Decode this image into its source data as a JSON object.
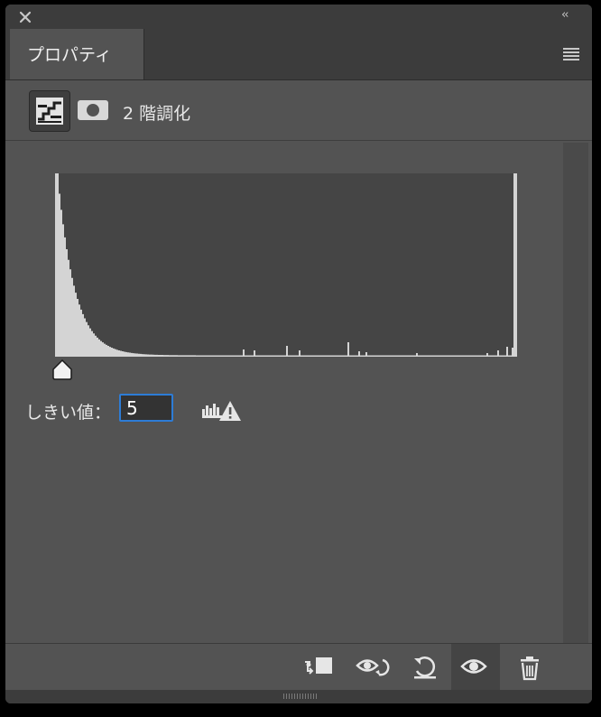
{
  "window": {
    "close_icon": "close-icon",
    "collapse_icon": "double-chevron-left-icon",
    "collapse_glyph": "‹‹"
  },
  "tabs": [
    {
      "label": "プロパティ",
      "active": true
    }
  ],
  "panel_menu_icon": "hamburger-menu-icon",
  "adjustment": {
    "icon": "threshold-adjustment-icon",
    "mask_icon": "layer-mask-icon",
    "title": "2 階調化"
  },
  "histogram": {
    "background": "#454545",
    "fill": "#d4d4d4",
    "bins": 256,
    "shape": "heavy left skew with long flat tail, small spikes near middle and right edge"
  },
  "threshold": {
    "label": "しきい値：",
    "value": "5",
    "warning_icon": "histogram-warning-icon"
  },
  "footer": {
    "buttons": [
      {
        "name": "clip-to-layer-button",
        "icon": "clip-to-layer-icon"
      },
      {
        "name": "view-previous-state-button",
        "icon": "eye-previous-icon"
      },
      {
        "name": "reset-button",
        "icon": "reset-icon"
      },
      {
        "name": "toggle-visibility-button",
        "icon": "eye-icon",
        "active": true
      },
      {
        "name": "delete-button",
        "icon": "trash-icon"
      }
    ]
  },
  "colors": {
    "panel_bg": "#535353",
    "header_bg": "#3c3c3c",
    "input_focus": "#2d7cd6"
  }
}
